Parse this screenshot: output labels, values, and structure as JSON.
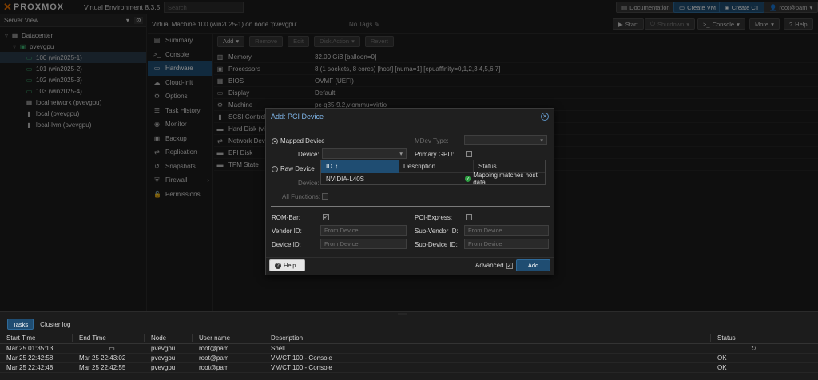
{
  "header": {
    "brand": "PROXMOX",
    "title": "Virtual Environment 8.3.5",
    "search_placeholder": "Search",
    "buttons": {
      "documentation": "Documentation",
      "create_vm": "Create VM",
      "create_ct": "Create CT",
      "user": "root@pam"
    }
  },
  "sidebar": {
    "view_label": "Server View",
    "datacenter": "Datacenter",
    "node": "pvevgpu",
    "vms": [
      "100 (win2025-1)",
      "101 (win2025-2)",
      "102 (win2025-3)",
      "103 (win2025-4)"
    ],
    "storages": [
      "localnetwork (pvevgpu)",
      "local (pvevgpu)",
      "local-lvm (pvevgpu)"
    ]
  },
  "vm_header": {
    "title": "Virtual Machine 100 (win2025-1) on node 'pvevgpu'",
    "tags": "No Tags",
    "start": "Start",
    "shutdown": "Shutdown",
    "console": "Console",
    "more": "More",
    "help": "Help"
  },
  "vm_menu": [
    "Summary",
    "Console",
    "Hardware",
    "Cloud-Init",
    "Options",
    "Task History",
    "Monitor",
    "Backup",
    "Replication",
    "Snapshots",
    "Firewall",
    "Permissions"
  ],
  "hw_toolbar": {
    "add": "Add",
    "remove": "Remove",
    "edit": "Edit",
    "disk_action": "Disk Action",
    "revert": "Revert"
  },
  "hardware": [
    {
      "name": "Memory",
      "value": "32.00 GiB [balloon=0]"
    },
    {
      "name": "Processors",
      "value": "8 (1 sockets, 8 cores) [host] [numa=1] [cpuaffinity=0,1,2,3,4,5,6,7]"
    },
    {
      "name": "BIOS",
      "value": "OVMF (UEFI)"
    },
    {
      "name": "Display",
      "value": "Default"
    },
    {
      "name": "Machine",
      "value": "pc-q35-9.2,viommu=virtio"
    },
    {
      "name": "SCSI Controller",
      "value": ""
    },
    {
      "name": "Hard Disk (virtio0)",
      "value": ""
    },
    {
      "name": "Network Device (net0)",
      "value": ""
    },
    {
      "name": "EFI Disk",
      "value": ""
    },
    {
      "name": "TPM State",
      "value": ""
    }
  ],
  "dialog": {
    "title": "Add: PCI Device",
    "mapped_device": "Mapped Device",
    "raw_device": "Raw Device",
    "device_label": "Device:",
    "mdev_type_label": "MDev Type:",
    "primary_gpu_label": "Primary GPU:",
    "all_functions_label": "All Functions:",
    "rom_bar_label": "ROM-Bar:",
    "pci_express_label": "PCI-Express:",
    "vendor_id_label": "Vendor ID:",
    "sub_vendor_id_label": "Sub-Vendor ID:",
    "device_id_label": "Device ID:",
    "sub_device_id_label": "Sub-Device ID:",
    "from_device": "From Device",
    "help": "Help",
    "advanced": "Advanced",
    "add": "Add",
    "dropdown": {
      "columns": {
        "id": "ID",
        "description": "Description",
        "status": "Status"
      },
      "row": {
        "id": "NVIDIA-L40S",
        "description": "",
        "status": "Mapping matches host data"
      }
    }
  },
  "tasks": {
    "tabs": [
      "Tasks",
      "Cluster log"
    ],
    "columns": [
      "Start Time",
      "End Time",
      "Node",
      "User name",
      "Description",
      "Status"
    ],
    "rows": [
      {
        "start": "Mar 25 01:35:13",
        "end": "",
        "node": "pvevgpu",
        "user": "root@pam",
        "desc": "Shell",
        "status": ""
      },
      {
        "start": "Mar 25 22:42:58",
        "end": "Mar 25 22:43:02",
        "node": "pvevgpu",
        "user": "root@pam",
        "desc": "VM/CT 100 - Console",
        "status": "OK"
      },
      {
        "start": "Mar 25 22:42:48",
        "end": "Mar 25 22:42:55",
        "node": "pvevgpu",
        "user": "root@pam",
        "desc": "VM/CT 100 - Console",
        "status": "OK"
      }
    ]
  },
  "colors": {
    "accent": "#1f4d72",
    "ok_green": "#2ea043",
    "background": "#1c1c1c"
  }
}
